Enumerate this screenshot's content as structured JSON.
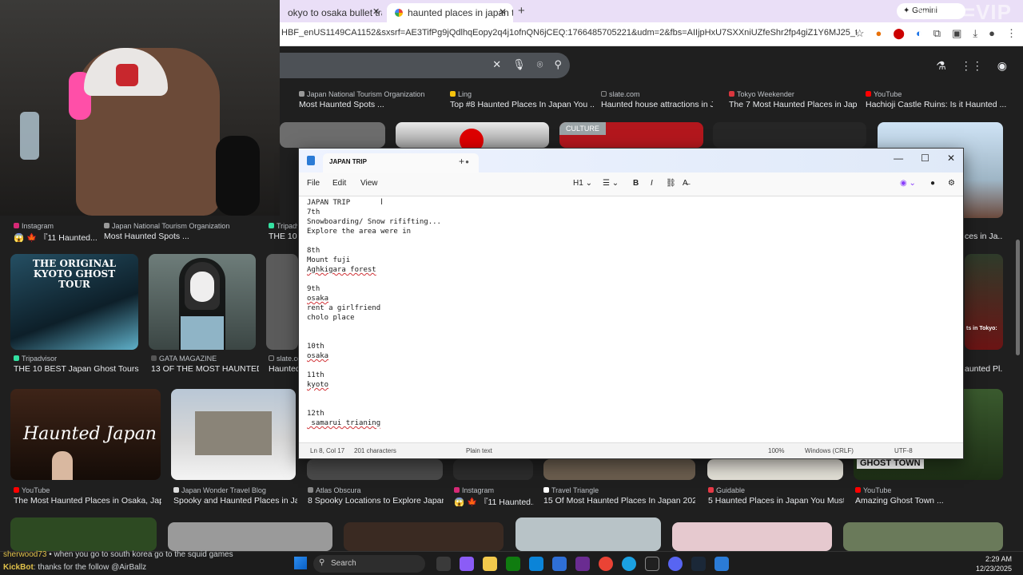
{
  "browser": {
    "tabs": [
      {
        "label": "okyo to osaka bullet train - Go"
      },
      {
        "label": "haunted places in japan to visit"
      }
    ],
    "new_tab": "+",
    "url": "HBF_enUS1149CA1152&sxsrf=AE3TifPg9jQdlhqEopy2q4j1ofnQN6jCEQ:1766485705221&udm=2&fbs=AIIjpHxU7SXXniUZfeShr2fp4giZ1Y6MJ25_tmWITc7uy4KIeoJTKjrFjVxydQ...",
    "gemini": "Gemini",
    "watermark": "SUB=VIP"
  },
  "results": [
    {
      "source": "Japan National Tourism Organization",
      "title": "Most Haunted Spots ..."
    },
    {
      "source": "Ling",
      "title": "Top #8 Haunted Places In Japan You ..."
    },
    {
      "source": "slate.com",
      "title": "Haunted house attractions in J..."
    },
    {
      "source": "Tokyo Weekender",
      "title": "The 7 Most Haunted Places in Jap..."
    },
    {
      "source": "YouTube",
      "title": "Hachioji Castle Ruins: Is it Haunted ..."
    },
    {
      "source": "Instagram",
      "title": "😱 🍁 『11 Haunted..."
    },
    {
      "source": "Japan National Tourism Organization",
      "title": "Most Haunted Spots ..."
    },
    {
      "source": "Tripadv",
      "title": "THE 10 E"
    },
    {
      "source": "Tripadvisor",
      "title": "THE 10 BEST Japan Ghost Tours (..."
    },
    {
      "source": "GATA MAGAZINE",
      "title": "13 OF THE MOST HAUNTED ..."
    },
    {
      "source": "slate.com",
      "title": "Haunted"
    },
    {
      "source": "YouTube",
      "title": "The Most Haunted Places in Osaka, Japa..."
    },
    {
      "source": "Japan Wonder Travel Blog",
      "title": "Spooky and Haunted Places in Ja..."
    },
    {
      "source": "Atlas Obscura",
      "title": "8 Spooky Locations to Explore Japan..."
    },
    {
      "source": "Instagram",
      "title": "😱 🍁 『11 Haunted..."
    },
    {
      "source": "Travel Triangle",
      "title": "15 Of Most Haunted Places In Japan 2025..."
    },
    {
      "source": "Guidable",
      "title": "5 Haunted Places in Japan You Must..."
    },
    {
      "source": "YouTube",
      "title": "Amazing Ghost Town ..."
    },
    {
      "source": "",
      "title": "ces in Ja..."
    },
    {
      "source": "",
      "title": "aunted Pl..."
    }
  ],
  "thumb_labels": {
    "culture": "CULTURE",
    "kyoto_tour": "THE ORIGINAL KYOTO GHOST TOUR",
    "haunted_japan": "Haunted Japan",
    "ghost_town": "GHOST TOWN",
    "tokyo_side": "ts in Tokyo:"
  },
  "notepad": {
    "tab_title": "JAPAN TRIP",
    "menu": [
      "File",
      "Edit",
      "View"
    ],
    "heading": "H1",
    "lines": [
      "JAPAN TRIP",
      "7th",
      "Snowboarding/ Snow rififting...",
      "Explore the area were in",
      "",
      "8th",
      "Mount fuji",
      "Aghkigara forest",
      "",
      "9th",
      "osaka",
      "rent a girlfriend",
      "cholo place",
      "",
      "",
      "10th",
      "osaka",
      "",
      "11th",
      "kyoto",
      "",
      "",
      "12th",
      " samarui trianing"
    ],
    "status": {
      "position": "Ln 8, Col 17",
      "chars": "201 characters",
      "type": "Plain text",
      "zoom": "100%",
      "eol": "Windows (CRLF)",
      "encoding": "UTF-8"
    }
  },
  "taskbar": {
    "chat_1": "• when you go to south korea go to the squid games",
    "chat_user_1": "sherwood73",
    "chat_2": ": thanks for the follow @AirBallz",
    "chat_user_2": "KickBot",
    "search": "Search",
    "time": "2:29 AM",
    "date": "12/23/2025"
  }
}
